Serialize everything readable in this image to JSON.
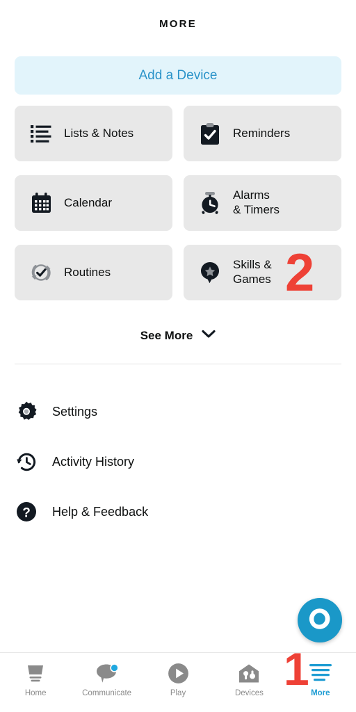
{
  "header": {
    "title": "MORE"
  },
  "add_device": {
    "label": "Add a Device",
    "bg_color": "#e2f4fb",
    "text_color": "#2a93c9"
  },
  "tiles": [
    {
      "label": "Lists & Notes",
      "icon": "list-icon"
    },
    {
      "label": "Reminders",
      "icon": "clipboard-check-icon"
    },
    {
      "label": "Calendar",
      "icon": "calendar-icon"
    },
    {
      "label_line1": "Alarms",
      "label_line2": "& Timers",
      "icon": "alarm-clock-icon"
    },
    {
      "label": "Routines",
      "icon": "routine-refresh-check-icon"
    },
    {
      "label_line1": "Skills &",
      "label_line2": "Games",
      "icon": "skills-star-pin-icon"
    }
  ],
  "see_more": {
    "label": "See More",
    "icon": "chevron-down-icon"
  },
  "menu": {
    "items": [
      {
        "label": "Settings",
        "icon": "gear-icon"
      },
      {
        "label": "Activity History",
        "icon": "clock-history-icon"
      },
      {
        "label": "Help & Feedback",
        "icon": "question-mark-icon"
      }
    ]
  },
  "fab": {
    "icon": "alexa-logo-icon",
    "color": "#1a98c8"
  },
  "bottom_nav": {
    "active_color": "#1f9dd3",
    "inactive_color": "#8a8a8a",
    "items": [
      {
        "label": "Home",
        "icon": "echo-device-icon",
        "active": false,
        "badge": false
      },
      {
        "label": "Communicate",
        "icon": "speech-bubble-icon",
        "active": false,
        "badge": true
      },
      {
        "label": "Play",
        "icon": "play-circle-icon",
        "active": false,
        "badge": false
      },
      {
        "label": "Devices",
        "icon": "home-devices-icon",
        "active": false,
        "badge": false
      },
      {
        "label": "More",
        "icon": "more-lines-icon",
        "active": true,
        "badge": false
      }
    ]
  },
  "annotations": [
    {
      "id": "annot-1",
      "text": "1",
      "color": "#ee4136"
    },
    {
      "id": "annot-2",
      "text": "2",
      "color": "#ee4136"
    }
  ]
}
